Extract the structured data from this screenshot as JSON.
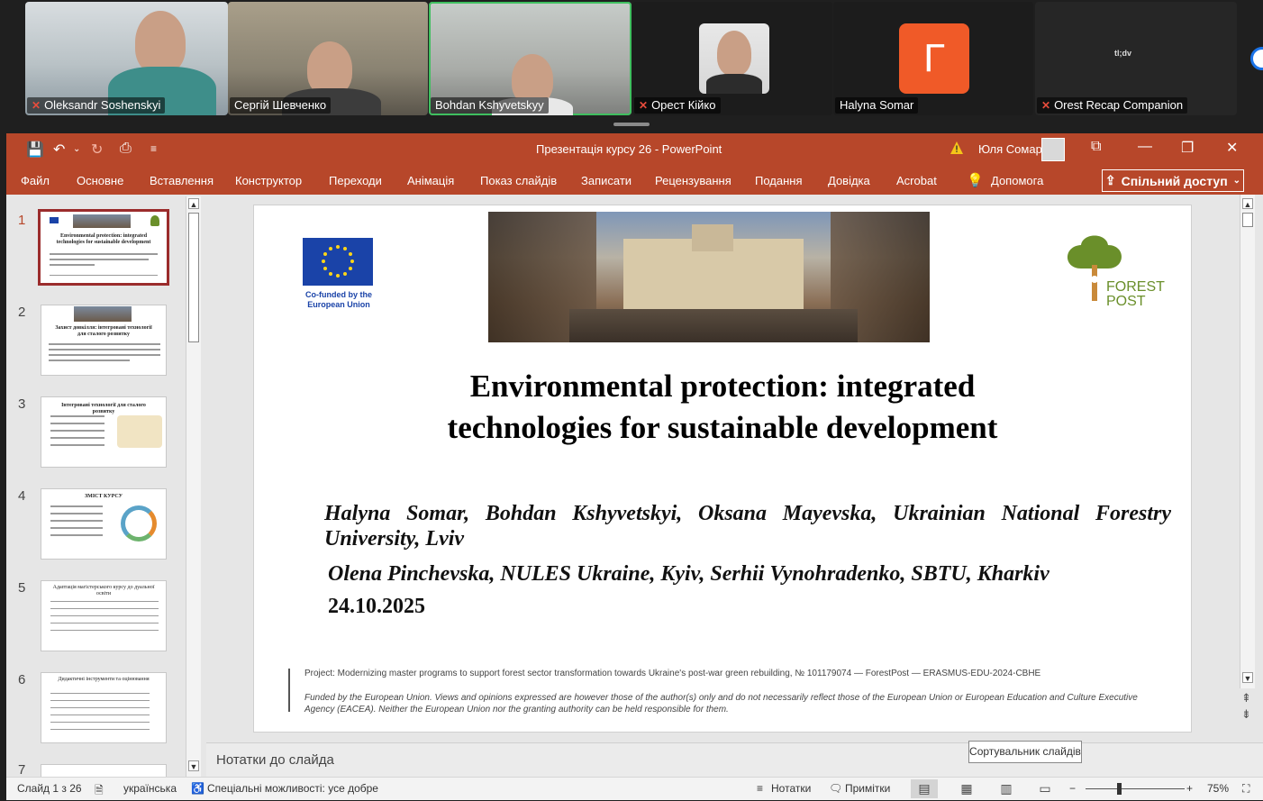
{
  "meeting": {
    "participants": [
      {
        "name": "Oleksandr Soshenskyi",
        "muted": true
      },
      {
        "name": "Сергій Шевченко",
        "muted": false
      },
      {
        "name": "Bohdan Kshyvetskyy",
        "muted": false,
        "speaking": true
      },
      {
        "name": "Орест Кійко",
        "muted": true
      },
      {
        "name": "Halyna Somar",
        "muted": false,
        "avatar_letter": "Г"
      },
      {
        "name": "Orest Recap Companion",
        "muted": true
      }
    ],
    "recap_logo": "tl;dv"
  },
  "ppt": {
    "title": "Презентація курсу 26  -  PowerPoint",
    "user": "Юля Сомар",
    "tabs": [
      "Файл",
      "Основне",
      "Вставлення",
      "Конструктор",
      "Переходи",
      "Анімація",
      "Показ слайдів",
      "Записати",
      "Рецензування",
      "Подання",
      "Довідка",
      "Acrobat",
      "Допомога"
    ],
    "share_label": "Спільний доступ",
    "thumbnails": [
      {
        "num": "1",
        "title": "Environmental protection: integrated technologies for sustainable development"
      },
      {
        "num": "2",
        "title": "Захист довкілля: інтегровані технології для сталого розвитку"
      },
      {
        "num": "3",
        "title": "Інтегровані технології для сталого розвитку"
      },
      {
        "num": "4",
        "title": "ЗМІСТ КУРСУ"
      },
      {
        "num": "5",
        "title": "Адаптація магістерського курсу до дуальної освіти"
      },
      {
        "num": "6",
        "title": "Дидактичні інструменти та оцінювання"
      },
      {
        "num": "7",
        "title": ""
      }
    ],
    "slide": {
      "eu_caption": "Co-funded by the European Union",
      "forest_logo_line1": "FOREST",
      "forest_logo_line2": "POST",
      "title_line1": "Environmental protection: integrated",
      "title_line2": "technologies for sustainable development",
      "authors_line1": "Halyna Somar, Bohdan Kshyvetskyi, Oksana Mayevska, Ukrainian National Forestry",
      "authors_line2": "University, Lviv",
      "authors_line3": "Olena Pinchevska, NULES Ukraine, Kyiv, Serhii Vynohradenko, SBTU, Kharkiv",
      "date": "24.10.2025",
      "footer_project": "Project: Modernizing master programs to support forest sector transformation towards Ukraine's post-war green rebuilding, № 101179074 — ForestPost — ERASMUS-EDU-2024-CBHE",
      "footer_funding": "Funded by the European Union. Views and opinions expressed are however those of the author(s) only and do not necessarily reflect those of the European Union or European Education and Culture Executive Agency (EACEA). Neither the European Union nor the granting authority can be held responsible for them."
    },
    "notes_placeholder": "Нотатки до слайда",
    "tooltip": "Сортувальник слайдів",
    "status": {
      "slide_counter": "Слайд 1 з 26",
      "language": "українська",
      "accessibility": "Спеціальні можливості: усе добре",
      "notes_btn": "Нотатки",
      "comments_btn": "Примітки",
      "zoom": "75%"
    },
    "colors": {
      "ribbon": "#b7472a",
      "eu_blue": "#1a43a8",
      "forest_green": "#6a8f2a"
    }
  }
}
